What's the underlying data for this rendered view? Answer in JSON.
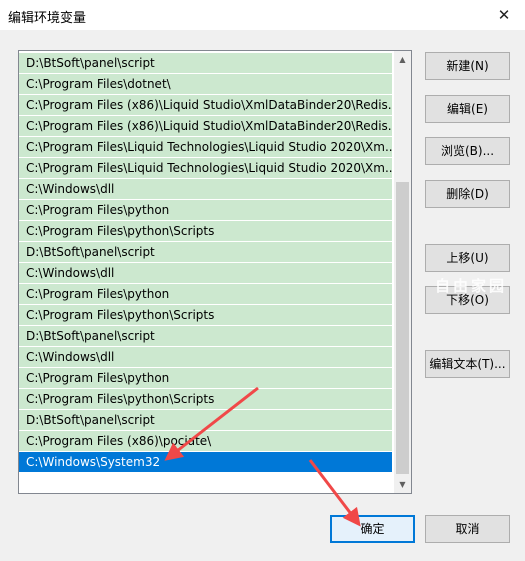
{
  "window": {
    "title": "编辑环境变量",
    "close_glyph": "✕"
  },
  "list": {
    "items": [
      "D:\\BtSoft\\panel\\script",
      "C:\\Program Files\\dotnet\\",
      "C:\\Program Files (x86)\\Liquid Studio\\XmlDataBinder20\\Redis...",
      "C:\\Program Files (x86)\\Liquid Studio\\XmlDataBinder20\\Redis...",
      "C:\\Program Files\\Liquid Technologies\\Liquid Studio 2020\\Xm...",
      "C:\\Program Files\\Liquid Technologies\\Liquid Studio 2020\\Xm...",
      "C:\\Windows\\dll",
      "C:\\Program Files\\python",
      "C:\\Program Files\\python\\Scripts",
      "D:\\BtSoft\\panel\\script",
      "C:\\Windows\\dll",
      "C:\\Program Files\\python",
      "C:\\Program Files\\python\\Scripts",
      "D:\\BtSoft\\panel\\script",
      "C:\\Windows\\dll",
      "C:\\Program Files\\python",
      "C:\\Program Files\\python\\Scripts",
      "D:\\BtSoft\\panel\\script",
      "C:\\Program Files (x86)\\pociate\\",
      "C:\\Windows\\System32"
    ],
    "selected_index": 19,
    "scroll_up_glyph": "▲",
    "scroll_down_glyph": "▼"
  },
  "buttons": {
    "new": "新建(N)",
    "edit": "编辑(E)",
    "browse": "浏览(B)...",
    "delete": "删除(D)",
    "move_up": "上移(U)",
    "move_down": "下移(O)",
    "edit_text": "编辑文本(T)...",
    "ok": "确定",
    "cancel": "取消"
  },
  "watermark": "自由家园",
  "colors": {
    "item_background": "#cce8cf",
    "selected_background": "#0078d7",
    "annotation_arrow": "#f04848"
  }
}
